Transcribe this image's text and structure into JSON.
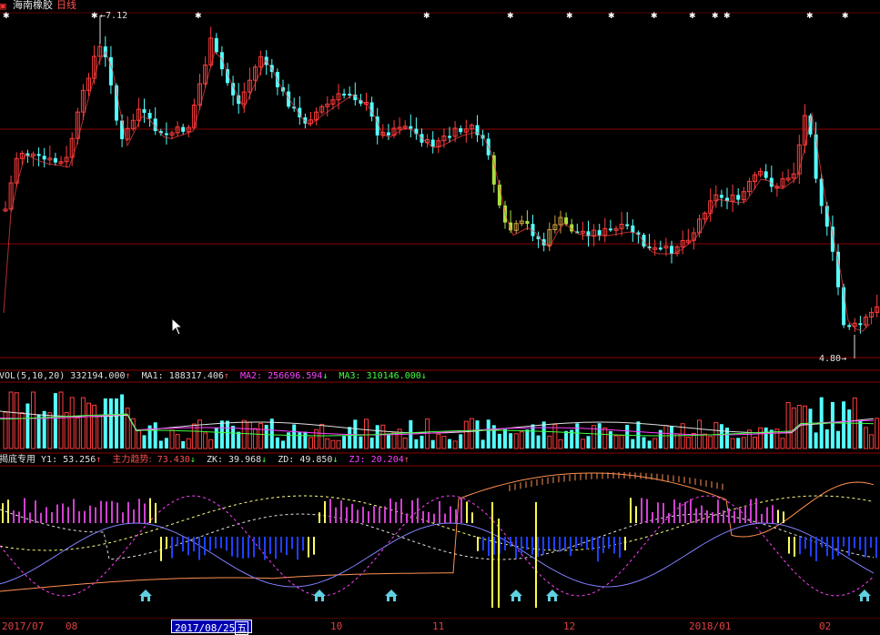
{
  "header": {
    "stock_name": "海南橡胶",
    "period": "日线",
    "menu_icon": "red-square-icon"
  },
  "price_panel": {
    "high_label": "7.12",
    "low_label": "4.80",
    "marker_icon": "star-marker-icon",
    "ma_line_color": "#ff4040",
    "up_color": "#ff3c3c",
    "down_color": "#54ffff"
  },
  "vol_panel": {
    "name": "VOL(5,10,20)",
    "value": "332194.000",
    "value_arrow": "↑",
    "ma1_label": "MA1:",
    "ma1_value": "188317.406",
    "ma1_arrow": "↑",
    "ma2_label": "MA2:",
    "ma2_value": "256696.594",
    "ma2_arrow": "↓",
    "ma3_label": "MA3:",
    "ma3_value": "310146.000",
    "ma3_arrow": "↓"
  },
  "indicator_panel": {
    "name": "揭底专用",
    "y1_label": "Y1:",
    "y1_value": "53.256",
    "y1_arrow": "↑",
    "zl_label": "主力趋势:",
    "zl_value": "73.430",
    "zl_arrow": "↓",
    "zk_label": "ZK:",
    "zk_value": "39.968",
    "zk_arrow": "↓",
    "zd_label": "ZD:",
    "zd_value": "49.850",
    "zd_arrow": "↓",
    "zj_label": "ZJ:",
    "zj_value": "20.204",
    "zj_arrow": "↑",
    "house_icon": "house-marker-icon"
  },
  "date_axis": {
    "labels": [
      "2017/07",
      "08",
      "10",
      "11",
      "12",
      "2018/01",
      "02"
    ],
    "cursor_date": "2017/08/25",
    "cursor_weekday": "五"
  }
}
